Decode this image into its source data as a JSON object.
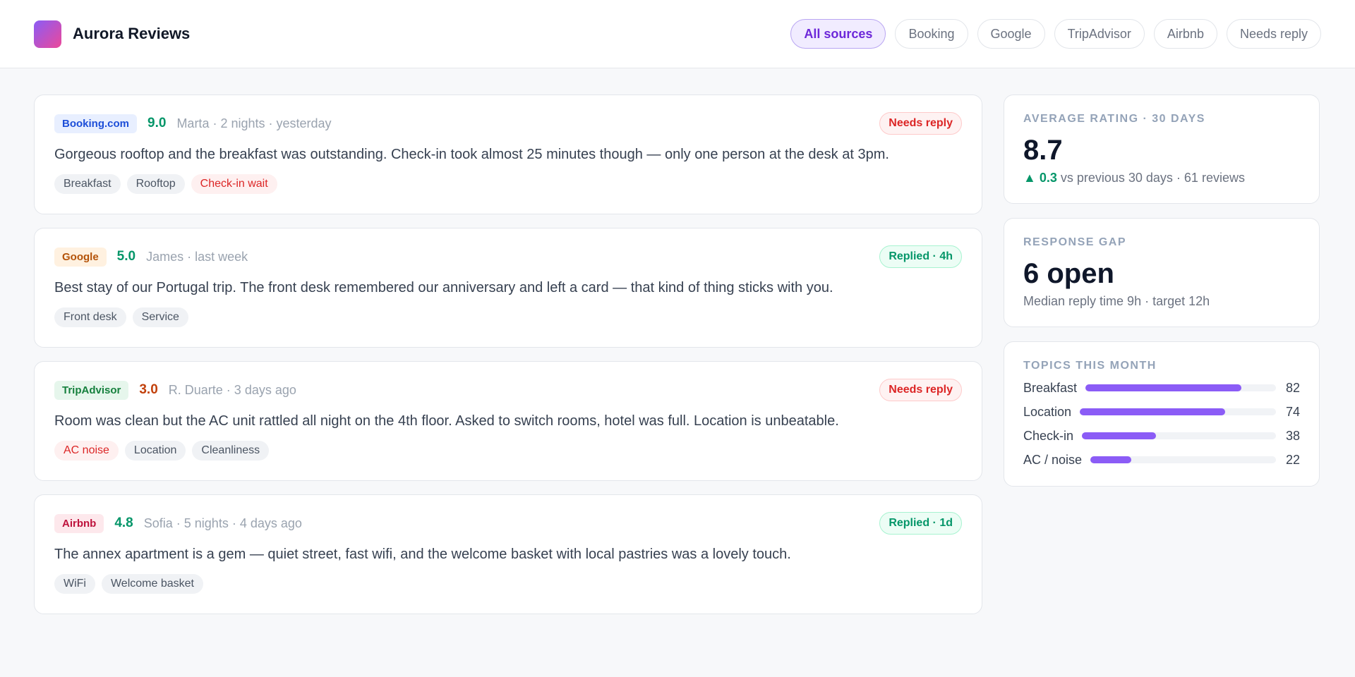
{
  "app": {
    "title": "Aurora Reviews"
  },
  "filters": [
    {
      "label": "All sources",
      "active": true
    },
    {
      "label": "Booking",
      "active": false
    },
    {
      "label": "Google",
      "active": false
    },
    {
      "label": "TripAdvisor",
      "active": false
    },
    {
      "label": "Airbnb",
      "active": false
    },
    {
      "label": "Needs reply",
      "active": false
    }
  ],
  "reviews": [
    {
      "source": "Booking.com",
      "source_bg": "#e8efff",
      "source_color": "#1d4ed8",
      "rating": "9.0",
      "rating_color": "#059669",
      "meta": "Marta · 2 nights · yesterday",
      "status": "Needs reply",
      "status_type": "needs",
      "text": "Gorgeous rooftop and the breakfast was outstanding. Check-in took almost 25 minutes though — only one person at the desk at 3pm.",
      "tags": [
        {
          "label": "Breakfast",
          "alert": false
        },
        {
          "label": "Rooftop",
          "alert": false
        },
        {
          "label": "Check-in wait",
          "alert": true
        }
      ]
    },
    {
      "source": "Google",
      "source_bg": "#fff1e0",
      "source_color": "#b45309",
      "rating": "5.0",
      "rating_color": "#059669",
      "meta": "James · last week",
      "status": "Replied · 4h",
      "status_type": "replied",
      "text": "Best stay of our Portugal trip. The front desk remembered our anniversary and left a card — that kind of thing sticks with you.",
      "tags": [
        {
          "label": "Front desk",
          "alert": false
        },
        {
          "label": "Service",
          "alert": false
        }
      ]
    },
    {
      "source": "TripAdvisor",
      "source_bg": "#e6f6ec",
      "source_color": "#15803d",
      "rating": "3.0",
      "rating_color": "#c2410c",
      "meta": "R. Duarte · 3 days ago",
      "status": "Needs reply",
      "status_type": "needs",
      "text": "Room was clean but the AC unit rattled all night on the 4th floor. Asked to switch rooms, hotel was full. Location is unbeatable.",
      "tags": [
        {
          "label": "AC noise",
          "alert": true
        },
        {
          "label": "Location",
          "alert": false
        },
        {
          "label": "Cleanliness",
          "alert": false
        }
      ]
    },
    {
      "source": "Airbnb",
      "source_bg": "#fde8ec",
      "source_color": "#be123c",
      "rating": "4.8",
      "rating_color": "#059669",
      "meta": "Sofia · 5 nights · 4 days ago",
      "status": "Replied · 1d",
      "status_type": "replied",
      "text": "The annex apartment is a gem — quiet street, fast wifi, and the welcome basket with local pastries was a lovely touch.",
      "tags": [
        {
          "label": "WiFi",
          "alert": false
        },
        {
          "label": "Welcome basket",
          "alert": false
        }
      ]
    }
  ],
  "stats": {
    "avg": {
      "label": "Average rating · 30 days",
      "value": "8.7",
      "delta": "▲ 0.3",
      "delta_text": " vs previous 30 days · 61 reviews"
    },
    "gap": {
      "label": "Response gap",
      "value": "6 open",
      "sub": "Median reply time 9h · target 12h"
    },
    "topics": {
      "label": "Topics this month",
      "max": 100,
      "items": [
        {
          "label": "Breakfast",
          "count": 82
        },
        {
          "label": "Location",
          "count": 74
        },
        {
          "label": "Check-in",
          "count": 38
        },
        {
          "label": "AC / noise",
          "count": 22
        }
      ]
    }
  },
  "colors": {
    "accent": "#8b5cf6",
    "positive": "#059669",
    "negative": "#dc2626"
  }
}
